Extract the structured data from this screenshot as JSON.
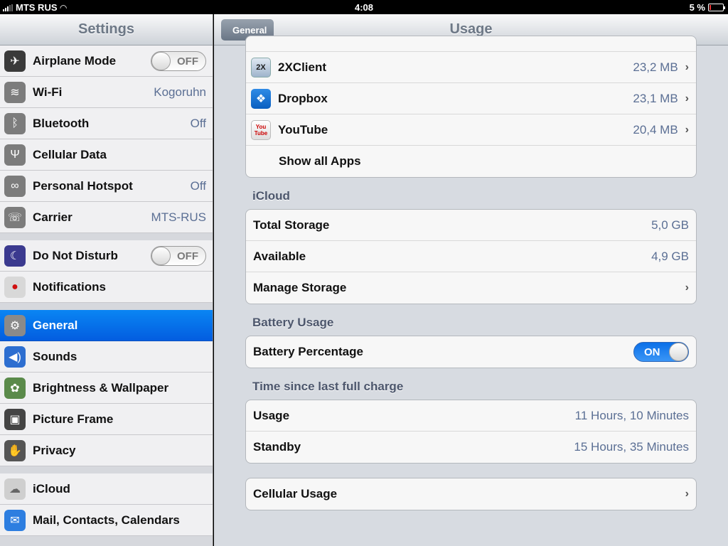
{
  "status_bar": {
    "carrier": "MTS RUS",
    "time": "4:08",
    "battery": "5 %",
    "battery_level": 0.05
  },
  "sidebar": {
    "title": "Settings",
    "items": [
      {
        "label": "Airplane Mode",
        "value": "",
        "toggle": "OFF",
        "icon": "airplane-icon"
      },
      {
        "label": "Wi-Fi",
        "value": "Kogoruhn",
        "icon": "wifi-icon"
      },
      {
        "label": "Bluetooth",
        "value": "Off",
        "icon": "bluetooth-icon"
      },
      {
        "label": "Cellular Data",
        "value": "",
        "icon": "antenna-icon"
      },
      {
        "label": "Personal Hotspot",
        "value": "Off",
        "icon": "hotspot-icon"
      },
      {
        "label": "Carrier",
        "value": "MTS-RUS",
        "icon": "phone-icon"
      },
      {
        "label": "Do Not Disturb",
        "value": "",
        "toggle": "OFF",
        "icon": "moon-icon"
      },
      {
        "label": "Notifications",
        "value": "",
        "icon": "notifications-icon"
      },
      {
        "label": "General",
        "value": "",
        "icon": "gear-icon",
        "selected": true
      },
      {
        "label": "Sounds",
        "value": "",
        "icon": "speaker-icon"
      },
      {
        "label": "Brightness & Wallpaper",
        "value": "",
        "icon": "flower-icon"
      },
      {
        "label": "Picture Frame",
        "value": "",
        "icon": "picture-frame-icon"
      },
      {
        "label": "Privacy",
        "value": "",
        "icon": "hand-icon"
      },
      {
        "label": "iCloud",
        "value": "",
        "icon": "cloud-icon"
      },
      {
        "label": "Mail, Contacts, Calendars",
        "value": "",
        "icon": "mail-icon"
      }
    ]
  },
  "detail": {
    "back_label": "General",
    "title": "Usage",
    "apps": [
      {
        "name": "2XClient",
        "size": "23,2 MB",
        "icon": "2x-client-icon",
        "icon_text": "2X"
      },
      {
        "name": "Dropbox",
        "size": "23,1 MB",
        "icon": "dropbox-icon",
        "icon_text": "❖"
      },
      {
        "name": "YouTube",
        "size": "20,4 MB",
        "icon": "youtube-icon",
        "icon_text": "You Tube"
      }
    ],
    "show_all_apps": "Show all Apps",
    "icloud": {
      "header": "iCloud",
      "total_storage_label": "Total Storage",
      "total_storage_value": "5,0 GB",
      "available_label": "Available",
      "available_value": "4,9 GB",
      "manage_storage_label": "Manage Storage"
    },
    "battery": {
      "header": "Battery Usage",
      "percentage_label": "Battery Percentage",
      "percentage_toggle": "ON"
    },
    "charge": {
      "header": "Time since last full charge",
      "usage_label": "Usage",
      "usage_value": "11 Hours, 10 Minutes",
      "standby_label": "Standby",
      "standby_value": "15 Hours, 35 Minutes"
    },
    "cellular_usage_label": "Cellular Usage"
  }
}
